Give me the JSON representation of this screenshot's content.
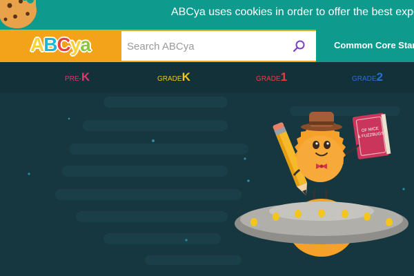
{
  "cookie_banner": {
    "text": "ABCya uses cookies in order to offer the best experience of our"
  },
  "header": {
    "logo": {
      "letters": [
        "A",
        "B",
        "C",
        "y",
        "a"
      ],
      "colors": [
        "#f7d23a",
        "#1fb6d6",
        "#e8413d",
        "#f7d23a",
        "#8cc63f"
      ]
    },
    "search": {
      "placeholder": "Search ABCya",
      "value": ""
    },
    "common_core_label": "Common Core Standards"
  },
  "grade_nav": [
    {
      "prefix": "PRE-",
      "grade": "K",
      "color": "#e8346b"
    },
    {
      "prefix": "GRADE",
      "grade": "K",
      "color": "#f4c51c"
    },
    {
      "prefix": "GRADE",
      "grade": "1",
      "color": "#e8413d"
    },
    {
      "prefix": "GRADE",
      "grade": "2",
      "color": "#2a6fd4"
    }
  ],
  "hero": {
    "book_text": [
      "OF MICE",
      "& FUZZBUGS"
    ]
  },
  "colors": {
    "teal": "#0e9a8c",
    "orange": "#f3a31a",
    "background": "#16373f",
    "nav": "#123139"
  }
}
